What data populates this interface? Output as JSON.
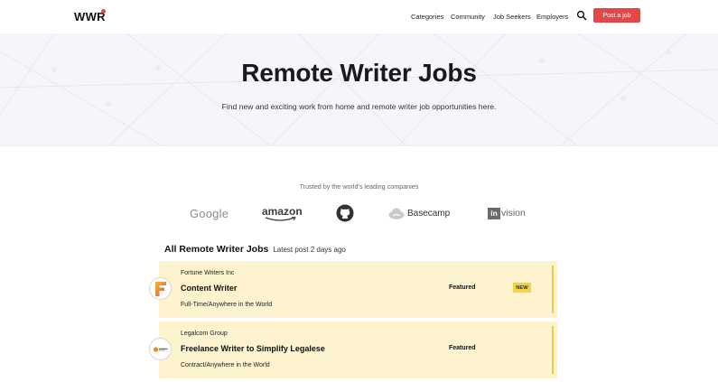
{
  "header": {
    "logo": "WWR",
    "nav": [
      "Categories",
      "Community",
      "Job Seekers",
      "Employers"
    ],
    "post_job": "Post a job"
  },
  "hero": {
    "title": "Remote Writer Jobs",
    "subtitle": "Find new and exciting work from home and remote writer job opportunities here."
  },
  "trusted": {
    "label": "Trusted by the world's leading companies",
    "companies": [
      "Google",
      "amazon",
      "github-icon",
      "Basecamp",
      "invision"
    ]
  },
  "jobs_section": {
    "title": "All Remote Writer Jobs",
    "latest": "Latest post 2 days ago"
  },
  "jobs": [
    {
      "company": "Fortune Writers Inc",
      "title": "Content Writer",
      "meta": "Full-Time/Anywhere in the World",
      "featured": "Featured",
      "badge": "NEW",
      "logo_letter": "F"
    },
    {
      "company": "Legalcom Group",
      "title": "Freelance Writer to Simplify Legalese",
      "meta": "Contract/Anywhere in the World",
      "featured": "Featured",
      "badge": ""
    }
  ],
  "colors": {
    "accent": "#e2474a",
    "featured_bg": "#fdf3cf",
    "featured_bar": "#f0c94b",
    "new_badge": "#f4d43e"
  }
}
